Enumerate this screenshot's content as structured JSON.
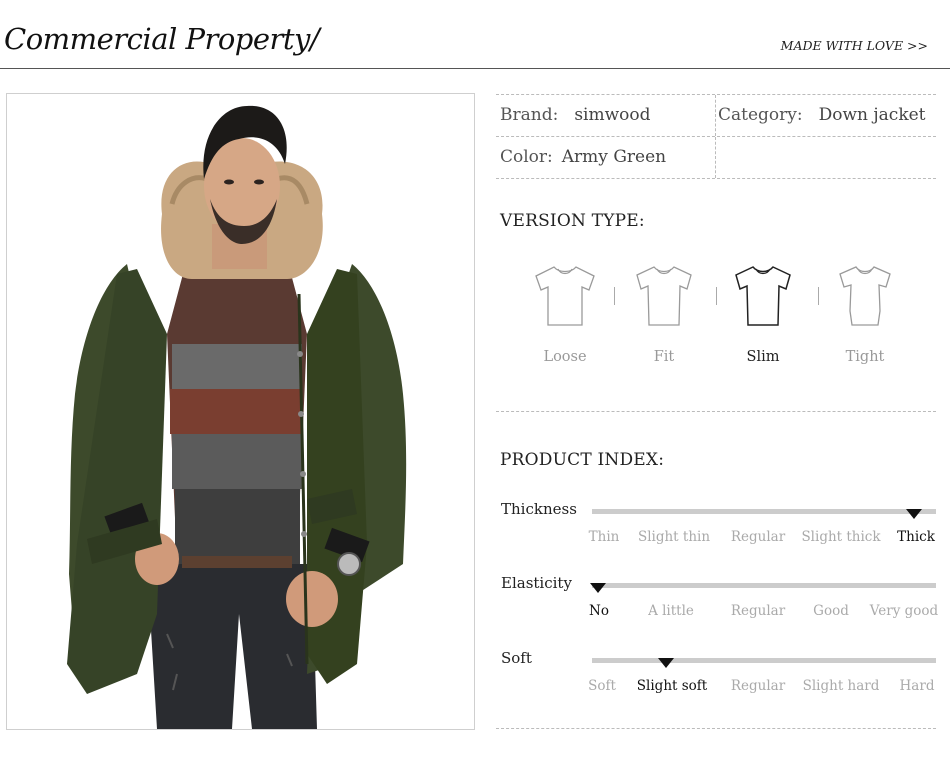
{
  "header": {
    "title": "Commercial Property/",
    "tagline": "MADE WITH LOVE >>"
  },
  "photo": {
    "subject": "man-in-army-green-down-jacket-with-fur-hood",
    "colors": {
      "jacket": "#3d4a2b",
      "fur": "#c9a882",
      "sweater": "#5a3a32",
      "jeans": "#2a2c30"
    }
  },
  "info": {
    "brand_label": "Brand:",
    "brand_value": "simwood",
    "category_label": "Category:",
    "category_value": "Down jacket",
    "color_label": "Color:",
    "color_value": "Army Green"
  },
  "version": {
    "title": "VERSION TYPE:",
    "items": [
      {
        "label": "Loose",
        "icon": "tshirt-loose-icon",
        "active": false
      },
      {
        "label": "Fit",
        "icon": "tshirt-fit-icon",
        "active": false
      },
      {
        "label": "Slim",
        "icon": "tshirt-slim-icon",
        "active": true
      },
      {
        "label": "Tight",
        "icon": "tshirt-tight-icon",
        "active": false
      }
    ]
  },
  "index": {
    "title": "PRODUCT INDEX:",
    "rows": [
      {
        "label": "Thickness",
        "options": [
          "Thin",
          "Slight thin",
          "Regular",
          "Slight thick",
          "Thick"
        ],
        "selected": 4
      },
      {
        "label": "Elasticity",
        "options": [
          "No",
          "A little",
          "Regular",
          "Good",
          "Very good"
        ],
        "selected": 0
      },
      {
        "label": "Soft",
        "options": [
          "Soft",
          "Slight soft",
          "Regular",
          "Slight hard",
          "Hard"
        ],
        "selected": 1
      }
    ]
  }
}
